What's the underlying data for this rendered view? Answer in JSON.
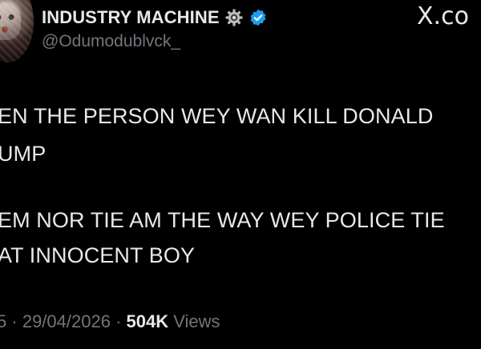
{
  "author": {
    "display_name": "INDUSTRY MACHINE",
    "handle": "@Odumodublvck_",
    "gear_icon": "gear-icon",
    "verified_icon": "verified-badge-icon",
    "verified_color": "#1d9bf0"
  },
  "brand": {
    "text": "X.co"
  },
  "tweet": {
    "lines": [
      "EN THE PERSON WEY WAN KILL DONALD",
      "UMP",
      "EM NOR TIE AM THE WAY WEY POLICE TIE",
      "AT INNOCENT BOY"
    ]
  },
  "meta": {
    "time_fragment": "5",
    "separator": "·",
    "date": "29/04/2026",
    "views_count": "504K",
    "views_label": "Views"
  },
  "colors": {
    "background": "#000000",
    "text_primary": "#e7e9ea",
    "text_secondary": "#71767b"
  }
}
